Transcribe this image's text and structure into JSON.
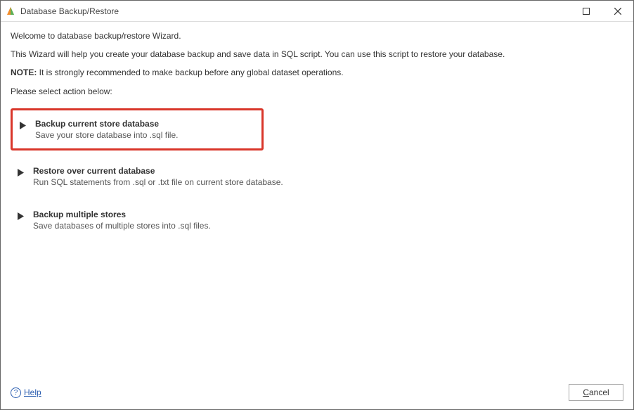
{
  "window": {
    "title": "Database Backup/Restore"
  },
  "intro": {
    "welcome": "Welcome to database backup/restore Wizard.",
    "description": "This Wizard will help you create your database backup and save data in SQL script. You can use this script to restore your database.",
    "note_label": "NOTE:",
    "note_text": " It is strongly recommended to make backup before any global dataset operations.",
    "select_prompt": "Please select action below:"
  },
  "options": {
    "backup_current": {
      "title": "Backup current store database",
      "desc": "Save your store database into .sql file."
    },
    "restore": {
      "title": "Restore over current database",
      "desc": "Run SQL statements from .sql or .txt file on current store database."
    },
    "backup_multiple": {
      "title": "Backup multiple stores",
      "desc": "Save databases of multiple stores into .sql files."
    }
  },
  "footer": {
    "help": "Help",
    "cancel_underline": "C",
    "cancel_rest": "ancel"
  }
}
